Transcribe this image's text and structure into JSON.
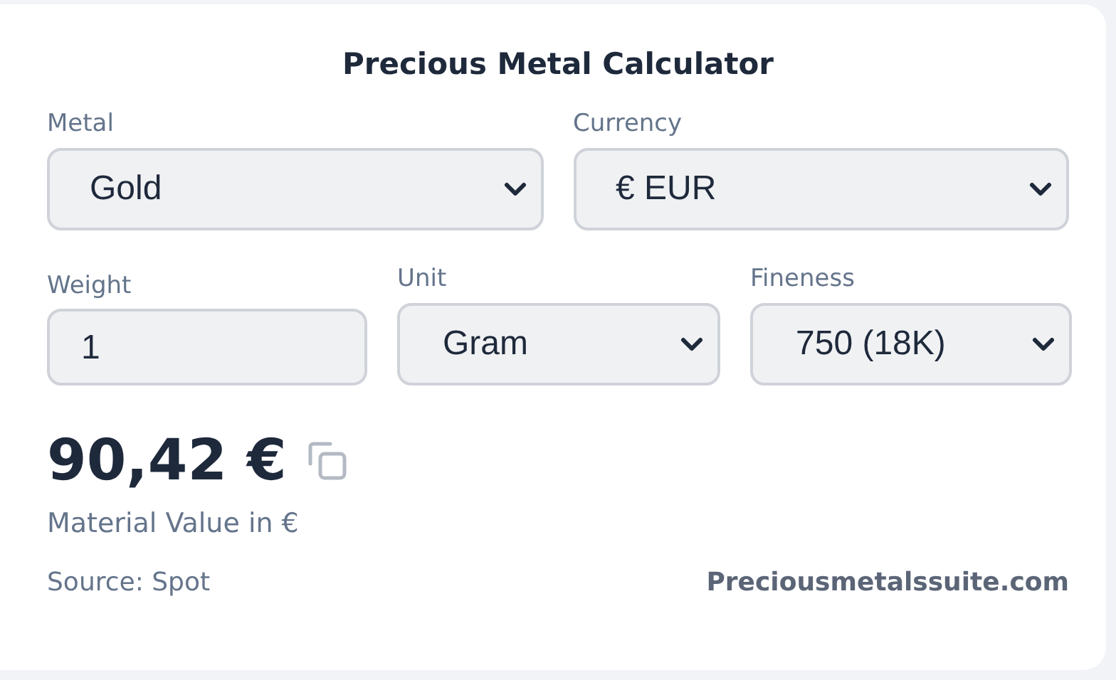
{
  "title": "Precious Metal Calculator",
  "fields_row_1": [
    {
      "label": "Metal",
      "value": "Gold"
    },
    {
      "label": "Currency",
      "value": "€ EUR"
    }
  ],
  "weight": {
    "label": "Weight",
    "value": "1"
  },
  "fields_row_2": [
    {
      "label": "Unit",
      "value": "Gram"
    },
    {
      "label": "Fineness",
      "value": "750 (18K)"
    }
  ],
  "result": {
    "value": "90,42 €",
    "caption": "Material Value in €"
  },
  "footer": {
    "source": "Source: Spot",
    "link": "Preciousmetalssuite.com"
  }
}
